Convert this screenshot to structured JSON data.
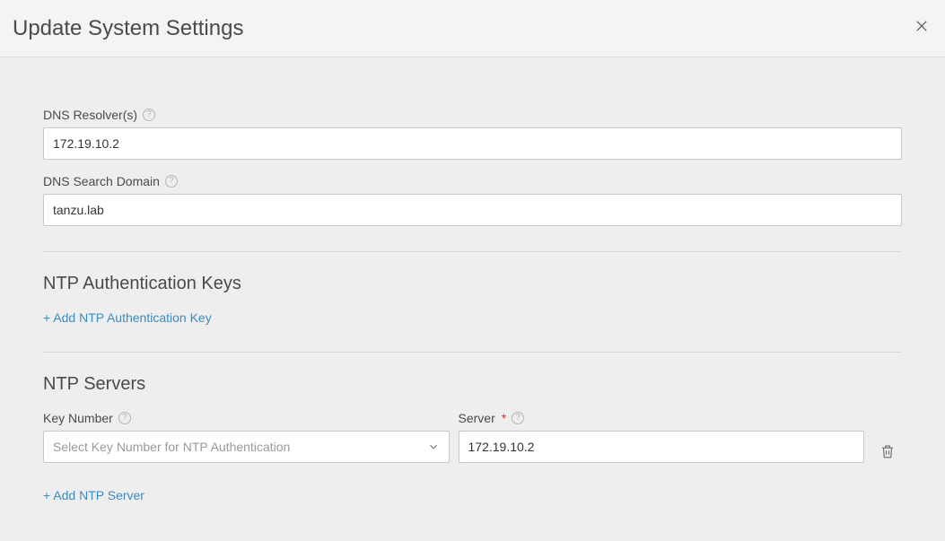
{
  "header": {
    "title": "Update System Settings"
  },
  "dns": {
    "resolver_label": "DNS Resolver(s)",
    "resolver_value": "172.19.10.2",
    "search_label": "DNS Search Domain",
    "search_value": "tanzu.lab"
  },
  "ntp_keys": {
    "title": "NTP Authentication Keys",
    "add_label": "+ Add NTP Authentication Key"
  },
  "ntp_servers": {
    "title": "NTP Servers",
    "key_number_label": "Key Number",
    "key_number_placeholder": "Select Key Number for NTP Authentication",
    "server_label": "Server",
    "server_value": "172.19.10.2",
    "add_label": "+ Add NTP Server"
  }
}
